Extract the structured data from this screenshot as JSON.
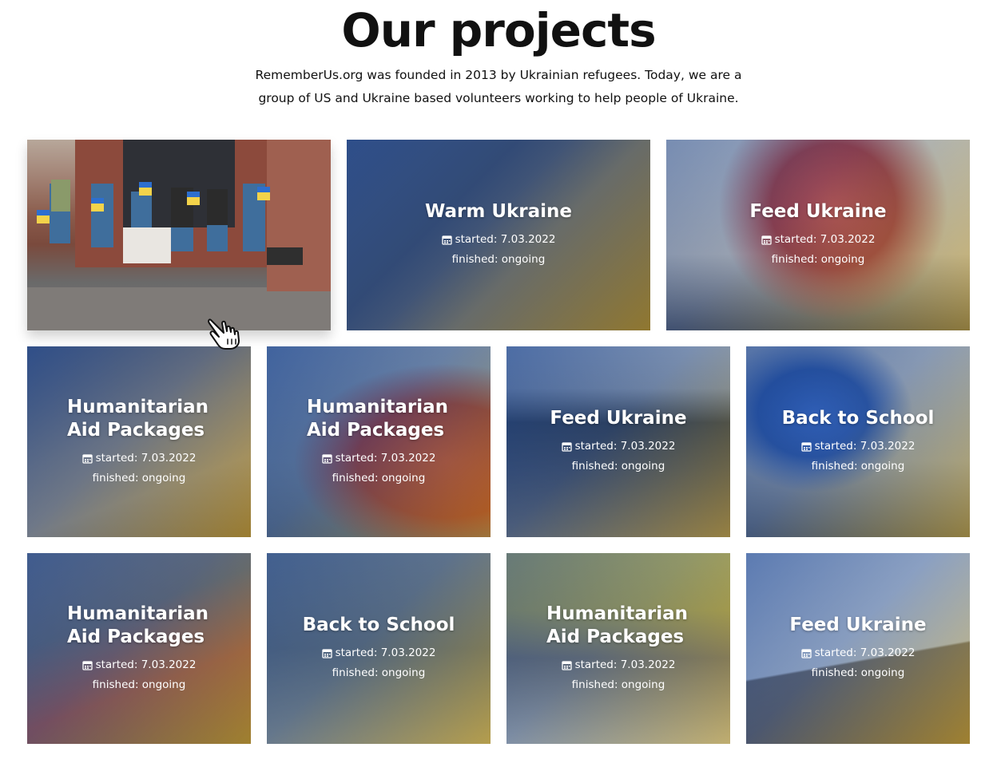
{
  "page": {
    "title": "Our projects",
    "intro": "RememberUs.org was founded in 2013 by Ukrainian refugees. Today, we are a group of US and Ukraine based volunteers working to help people of Ukraine."
  },
  "colors": {
    "overlay_blue": "#1f4e9a",
    "overlay_yellow": "#c9a21a",
    "text": "#111111",
    "white": "#ffffff"
  },
  "projects": [
    {
      "title": "",
      "started": "",
      "finished": "",
      "featured": true,
      "photo": "volunteers-with-flags"
    },
    {
      "title": "Warm Ukraine",
      "started": "started: 7.03.2022",
      "finished": "finished: ongoing"
    },
    {
      "title": "Feed Ukraine",
      "started": "started: 7.03.2022",
      "finished": "finished: ongoing"
    },
    {
      "title": "Humanitarian Aid Packages",
      "started": "started: 7.03.2022",
      "finished": "finished: ongoing"
    },
    {
      "title": "Humanitarian Aid Packages",
      "started": "started: 7.03.2022",
      "finished": "finished: ongoing"
    },
    {
      "title": "Feed Ukraine",
      "started": "started: 7.03.2022",
      "finished": "finished: ongoing"
    },
    {
      "title": "Back to School",
      "started": "started: 7.03.2022",
      "finished": "finished: ongoing"
    },
    {
      "title": "Humanitarian Aid Packages",
      "started": "started: 7.03.2022",
      "finished": "finished: ongoing"
    },
    {
      "title": "Back to School",
      "started": "started: 7.03.2022",
      "finished": "finished: ongoing"
    },
    {
      "title": "Humanitarian Aid Packages",
      "started": "started: 7.03.2022",
      "finished": "finished: ongoing"
    },
    {
      "title": "Feed Ukraine",
      "started": "started: 7.03.2022",
      "finished": "finished: ongoing"
    }
  ],
  "icons": {
    "calendar": "calendar-icon",
    "cursor": "hand-pointer-icon"
  }
}
